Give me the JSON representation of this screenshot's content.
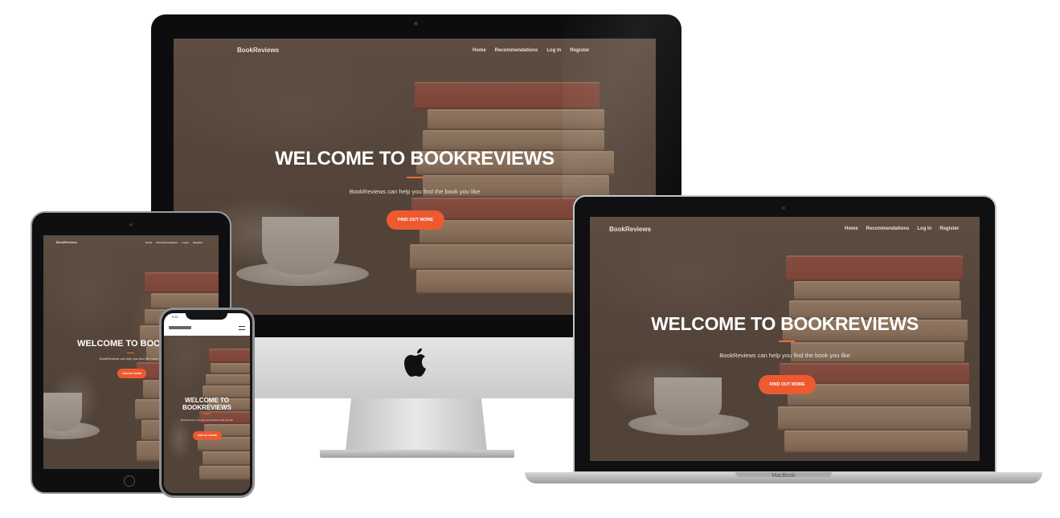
{
  "brand": "BookReviews",
  "nav": [
    "Home",
    "Recommendations",
    "Log In",
    "Register"
  ],
  "hero": {
    "title": "WELCOME TO BOOKREVIEWS",
    "title_truncated": "WELCOME TO BOOKRE",
    "title_line1": "WELCOME TO",
    "title_line2": "BOOKREVIEWS",
    "subtitle": "BookReviews can help you find the book you like",
    "button": "FIND OUT MORE"
  },
  "devices": {
    "laptop_label": "MacBook",
    "phone_time": "9:41"
  },
  "colors": {
    "accent": "#ee5a30",
    "overlay": "#5c4c40",
    "text": "#ffffff"
  }
}
